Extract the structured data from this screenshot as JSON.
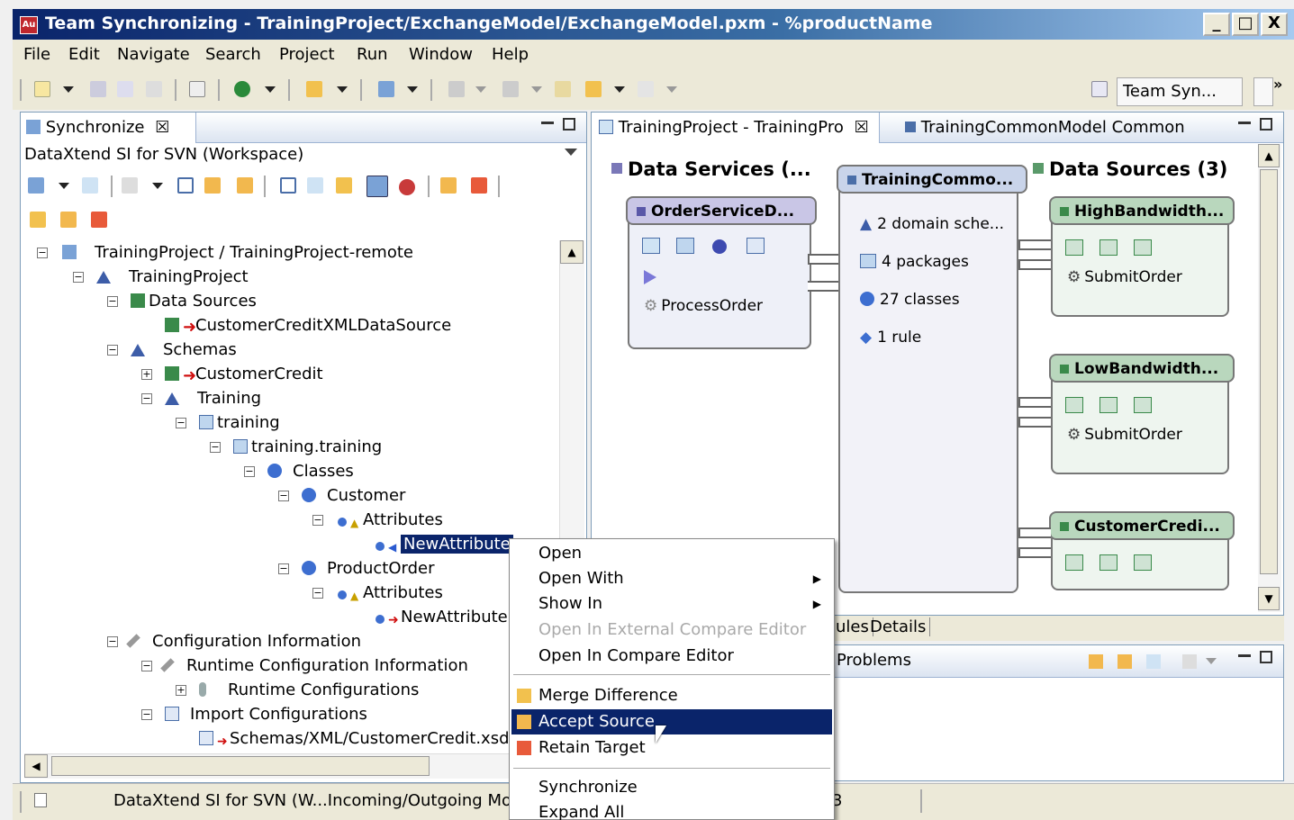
{
  "window": {
    "title": "Team Synchronizing - TrainingProject/ExchangeModel/ExchangeModel.pxm - %productName",
    "app_icon": "Au",
    "minimize": "_",
    "maximize": "□",
    "close": "X"
  },
  "menu": [
    "File",
    "Edit",
    "Navigate",
    "Search",
    "Project",
    "Run",
    "Window",
    "Help"
  ],
  "perspective": {
    "label": "Team Syn...",
    "more": "»"
  },
  "sync_view": {
    "tab_label": "Synchronize",
    "close": "☒",
    "description": "DataXtend SI for SVN (Workspace)",
    "tree": [
      {
        "label": "TrainingProject / TrainingProject-remote"
      },
      {
        "label": "TrainingProject"
      },
      {
        "label": "Data Sources"
      },
      {
        "label": "CustomerCreditXMLDataSource"
      },
      {
        "label": "Schemas"
      },
      {
        "label": "CustomerCredit"
      },
      {
        "label": "Training"
      },
      {
        "label": "training"
      },
      {
        "label": "training.training"
      },
      {
        "label": "Classes"
      },
      {
        "label": "Customer"
      },
      {
        "label": "Attributes"
      },
      {
        "label": "NewAttribute"
      },
      {
        "label": "ProductOrder"
      },
      {
        "label": "Attributes"
      },
      {
        "label": "NewAttribute"
      },
      {
        "label": "Configuration Information"
      },
      {
        "label": "Runtime Configuration Information"
      },
      {
        "label": "Runtime Configurations"
      },
      {
        "label": "Import Configurations"
      },
      {
        "label": "Schemas/XML/CustomerCredit.xsd"
      }
    ]
  },
  "editor": {
    "tabs": [
      {
        "label": "TrainingProject - TrainingPro"
      },
      {
        "label": "TrainingCommonModel Common"
      }
    ],
    "tab_close": "☒",
    "columns": {
      "services": "Data Services (...",
      "common": "TrainingCommo...",
      "sources": "Data Sources (3)"
    },
    "service_node": {
      "title": "OrderServiceD...",
      "item": "ProcessOrder"
    },
    "common_items": [
      "2 domain sche...",
      "4 packages",
      "27 classes",
      "1 rule"
    ],
    "source_nodes": [
      {
        "title": "HighBandwidth...",
        "item": "SubmitOrder"
      },
      {
        "title": "LowBandwidth...",
        "item": "SubmitOrder"
      },
      {
        "title": "CustomerCredi...",
        "item": ""
      }
    ],
    "bottom_tabs": [
      "ules",
      "Details"
    ]
  },
  "problems": {
    "label": "Problems"
  },
  "status": {
    "text": "DataXtend SI for SVN (W...Incoming/Outgoing Mo",
    "trailing": "3"
  },
  "context_menu": {
    "items": [
      {
        "label": "Open",
        "submenu": false,
        "disabled": false
      },
      {
        "label": "Open With",
        "submenu": true,
        "disabled": false
      },
      {
        "label": "Show In",
        "submenu": true,
        "disabled": false
      },
      {
        "label": "Open In External Compare Editor",
        "submenu": false,
        "disabled": true
      },
      {
        "label": "Open In Compare Editor",
        "submenu": false,
        "disabled": false
      },
      {
        "label": "Merge Difference",
        "submenu": false,
        "disabled": false
      },
      {
        "label": "Accept Source",
        "submenu": false,
        "disabled": false,
        "highlighted": true
      },
      {
        "label": "Retain Target",
        "submenu": false,
        "disabled": false
      },
      {
        "label": "Synchronize",
        "submenu": false,
        "disabled": false
      },
      {
        "label": "Expand All",
        "submenu": false,
        "disabled": false
      }
    ],
    "submenu_arrow": "▶"
  },
  "colors": {
    "selection": "#0a246a",
    "node_header": "#c9c6e6",
    "source_header": "#b9d7bd",
    "titlebar": "#0a246a"
  }
}
